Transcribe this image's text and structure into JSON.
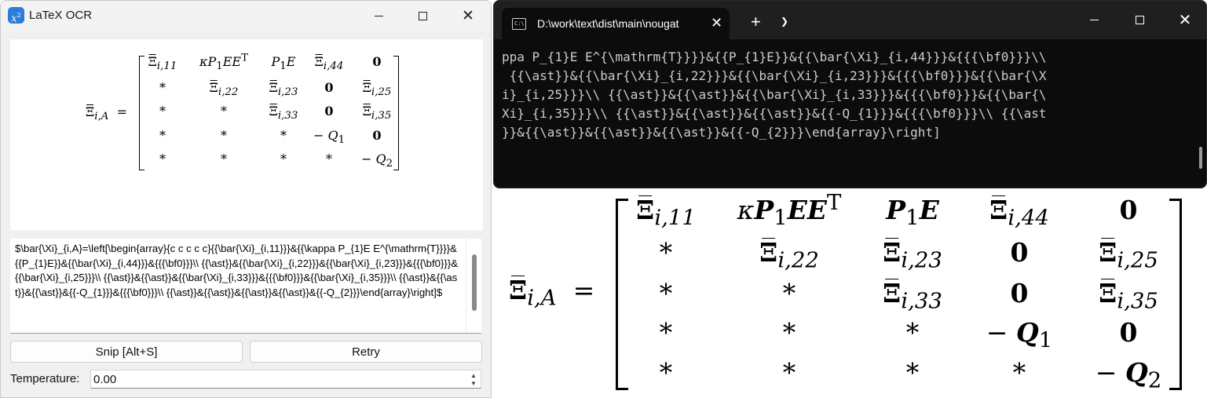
{
  "ocr_window": {
    "title": "LaTeX OCR",
    "app_icon_base": "x",
    "app_icon_exp": "2",
    "latex_source": "$\\bar{\\Xi}_{i,A}=\\left[\\begin{array}{c c c c c}{{\\bar{\\Xi}_{i,11}}}&{{\\kappa P_{1}E E^{\\mathrm{T}}}}&{{P_{1}E}}&{{\\bar{\\Xi}_{i,44}}}&{{{\\bf0}}}\\\\ {{\\ast}}&{{\\bar{\\Xi}_{i,22}}}&{{\\bar{\\Xi}_{i,23}}}&{{{\\bf0}}}&{{\\bar{\\Xi}_{i,25}}}\\\\ {{\\ast}}&{{\\ast}}&{{\\bar{\\Xi}_{i,33}}}&{{{\\bf0}}}&{{\\bar{\\Xi}_{i,35}}}\\\\ {{\\ast}}&{{\\ast}}&{{\\ast}}&{{-Q_{1}}}&{{{\\bf0}}}\\\\ {{\\ast}}&{{\\ast}}&{{\\ast}}&{{\\ast}}&{{-Q_{2}}}\\end{array}\\right]$",
    "snip_button": "Snip [Alt+S]",
    "retry_button": "Retry",
    "temperature_label": "Temperature:",
    "temperature_value": "0.00"
  },
  "terminal": {
    "tab_title": "D:\\work\\text\\dist\\main\\nougat",
    "tab_icon": "C:\\",
    "lines": [
      "ppa P_{1}E E^{\\mathrm{T}}}}&{{P_{1}E}}&{{\\bar{\\Xi}_{i,44}}}&{{{\\bf0}}}\\\\",
      " {{\\ast}}&{{\\bar{\\Xi}_{i,22}}}&{{\\bar{\\Xi}_{i,23}}}&{{{\\bf0}}}&{{\\bar{\\X",
      "i}_{i,25}}}\\\\ {{\\ast}}&{{\\ast}}&{{\\bar{\\Xi}_{i,33}}}&{{{\\bf0}}}&{{\\bar{\\",
      "Xi}_{i,35}}}\\\\ {{\\ast}}&{{\\ast}}&{{\\ast}}&{{-Q_{1}}}&{{{\\bf0}}}\\\\ {{\\ast",
      "}}&{{\\ast}}&{{\\ast}}&{{\\ast}}&{{-Q_{2}}}\\end{array}\\right]"
    ]
  },
  "equation": {
    "lhs_symbol": "Ξ",
    "lhs_sub": "i,A",
    "equals": "=",
    "row1": [
      "Ξ|i,11",
      "κP₁EEᵀ",
      "P₁E",
      "Ξ|i,44",
      "0"
    ],
    "row2": [
      "*",
      "Ξ|i,22",
      "Ξ|i,23",
      "0",
      "Ξ|i,25"
    ],
    "row3": [
      "*",
      "*",
      "Ξ|i,33",
      "0",
      "Ξ|i,35"
    ],
    "row4": [
      "*",
      "*",
      "*",
      "−Q₁",
      "0"
    ],
    "row5": [
      "*",
      "*",
      "*",
      "*",
      "−Q₂"
    ],
    "kappa": "κ",
    "P": "P",
    "E": "E",
    "T": "T",
    "Q": "Q",
    "minus": "−",
    "one": "1",
    "two": "2"
  }
}
